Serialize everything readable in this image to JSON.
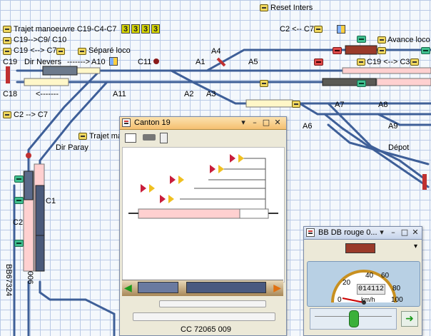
{
  "layout": {
    "labels": {
      "reset_inters": "Reset Inters",
      "trajet_c19": "Trajet manoeuvre C19-C4-C7",
      "c19_c9_c10": "C19-->C9/ C10",
      "c19_c7": "C19 <--> C7",
      "separe_loco": "Séparé loco",
      "c2_c7": "C2 <-- C7",
      "avance_loco": "Avance loco",
      "c19": "C19",
      "dir_nevers": "Dir Nevers",
      "arrow_right": "------->",
      "a10": "A10",
      "c11": "C11",
      "a1": "A1",
      "a4": "A4",
      "a5": "A5",
      "c19_c3": "C19 <--> C3",
      "c18": "C18",
      "arrow_left": "<-------",
      "a11": "A11",
      "a2": "A2",
      "a3": "A3",
      "a7": "A7",
      "a8": "A8",
      "c2_c7b": "C2 --> C7",
      "a6": "A6",
      "a9": "A9",
      "trajet_ma": "Trajet ma",
      "dir_paray": "Dir Paray",
      "depot": "Dépot",
      "c1": "C1",
      "c2": "C2",
      "bb_label": "BB67324",
      "num006": "006"
    },
    "route_numbers": [
      "3",
      "3",
      "3",
      "3"
    ]
  },
  "canton_window": {
    "title": "Canton 19",
    "status": "CC 72065 009"
  },
  "loco_window": {
    "title": "BB DB rouge  0...",
    "speed_value": "014112",
    "speed_unit": "km/h",
    "ticks": [
      "0",
      "20",
      "40",
      "60",
      "80",
      "100"
    ]
  }
}
